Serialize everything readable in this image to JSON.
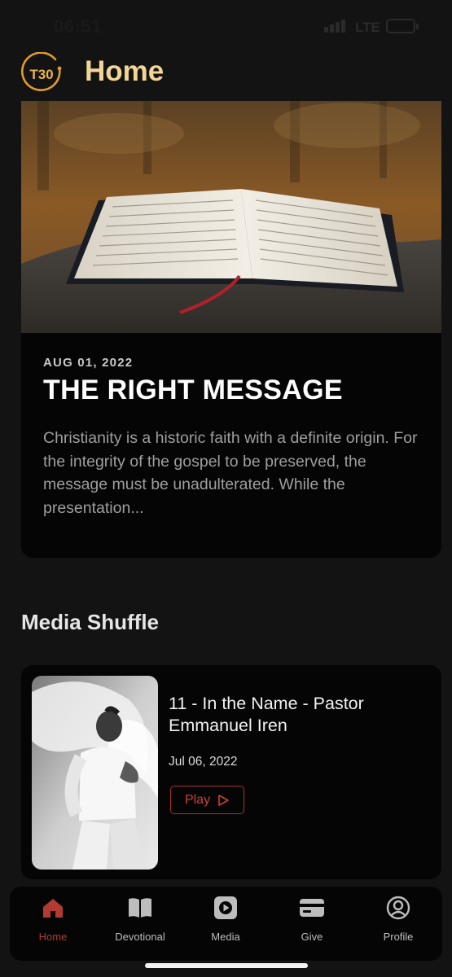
{
  "status_bar": {
    "time": "06:51",
    "network": "LTE"
  },
  "header": {
    "logo_text": "T30",
    "title": "Home"
  },
  "featured": {
    "date": "AUG 01, 2022",
    "title": "THE RIGHT MESSAGE",
    "excerpt": "Christianity is a historic faith with a definite origin. For the integrity of the gospel to be preserved, the message must be unadulterated. While the presentation..."
  },
  "media_shuffle": {
    "section_title": "Media Shuffle",
    "item": {
      "title": "11 - In the Name - Pastor Emmanuel Iren",
      "date": "Jul 06, 2022",
      "play_label": "Play"
    }
  },
  "bottom_nav": {
    "items": [
      {
        "label": "Home",
        "icon": "home-icon",
        "active": true
      },
      {
        "label": "Devotional",
        "icon": "book-icon",
        "active": false
      },
      {
        "label": "Media",
        "icon": "play-icon",
        "active": false
      },
      {
        "label": "Give",
        "icon": "card-icon",
        "active": false
      },
      {
        "label": "Profile",
        "icon": "profile-icon",
        "active": false
      }
    ]
  },
  "colors": {
    "accent_gold": "#f3d597",
    "accent_red": "#b33a33",
    "background": "#131313",
    "card": "#050505"
  }
}
